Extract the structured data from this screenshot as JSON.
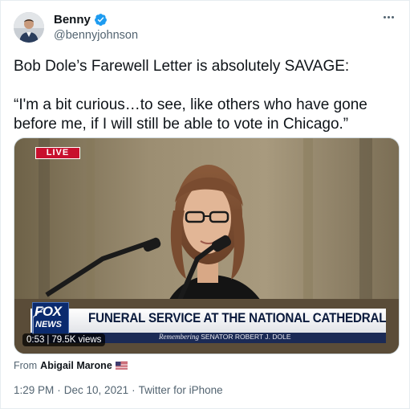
{
  "author": {
    "display_name": "Benny",
    "handle": "@bennyjohnson",
    "verified": true
  },
  "tweet": {
    "text_line1": "Bob Dole’s Farewell Letter is absolutely SAVAGE:",
    "text_line2": "“I'm a bit curious…to see, like others who have gone before me, if I will still be able to vote in Chicago.”"
  },
  "media": {
    "live_label": "LIVE",
    "network_logo_top": "FOX",
    "network_logo_bottom": "NEWS",
    "headline": "FUNERAL SERVICE AT THE NATIONAL CATHEDRAL",
    "subline_italic": "Remembering",
    "subline_name": "SENATOR ROBERT J. DOLE",
    "duration": "0:53",
    "separator": "|",
    "views": "79.5K views"
  },
  "attribution": {
    "from_label": "From",
    "from_author": "Abigail Marone",
    "flag_icon": "us-flag-icon"
  },
  "meta": {
    "time": "1:29 PM",
    "dot1": "·",
    "date": "Dec 10, 2021",
    "dot2": "·",
    "client": "Twitter for iPhone"
  },
  "colors": {
    "verified_blue": "#1d9bf0",
    "live_red": "#c8102e",
    "fox_blue": "#0a2a6e",
    "secondary_text": "#536471"
  }
}
